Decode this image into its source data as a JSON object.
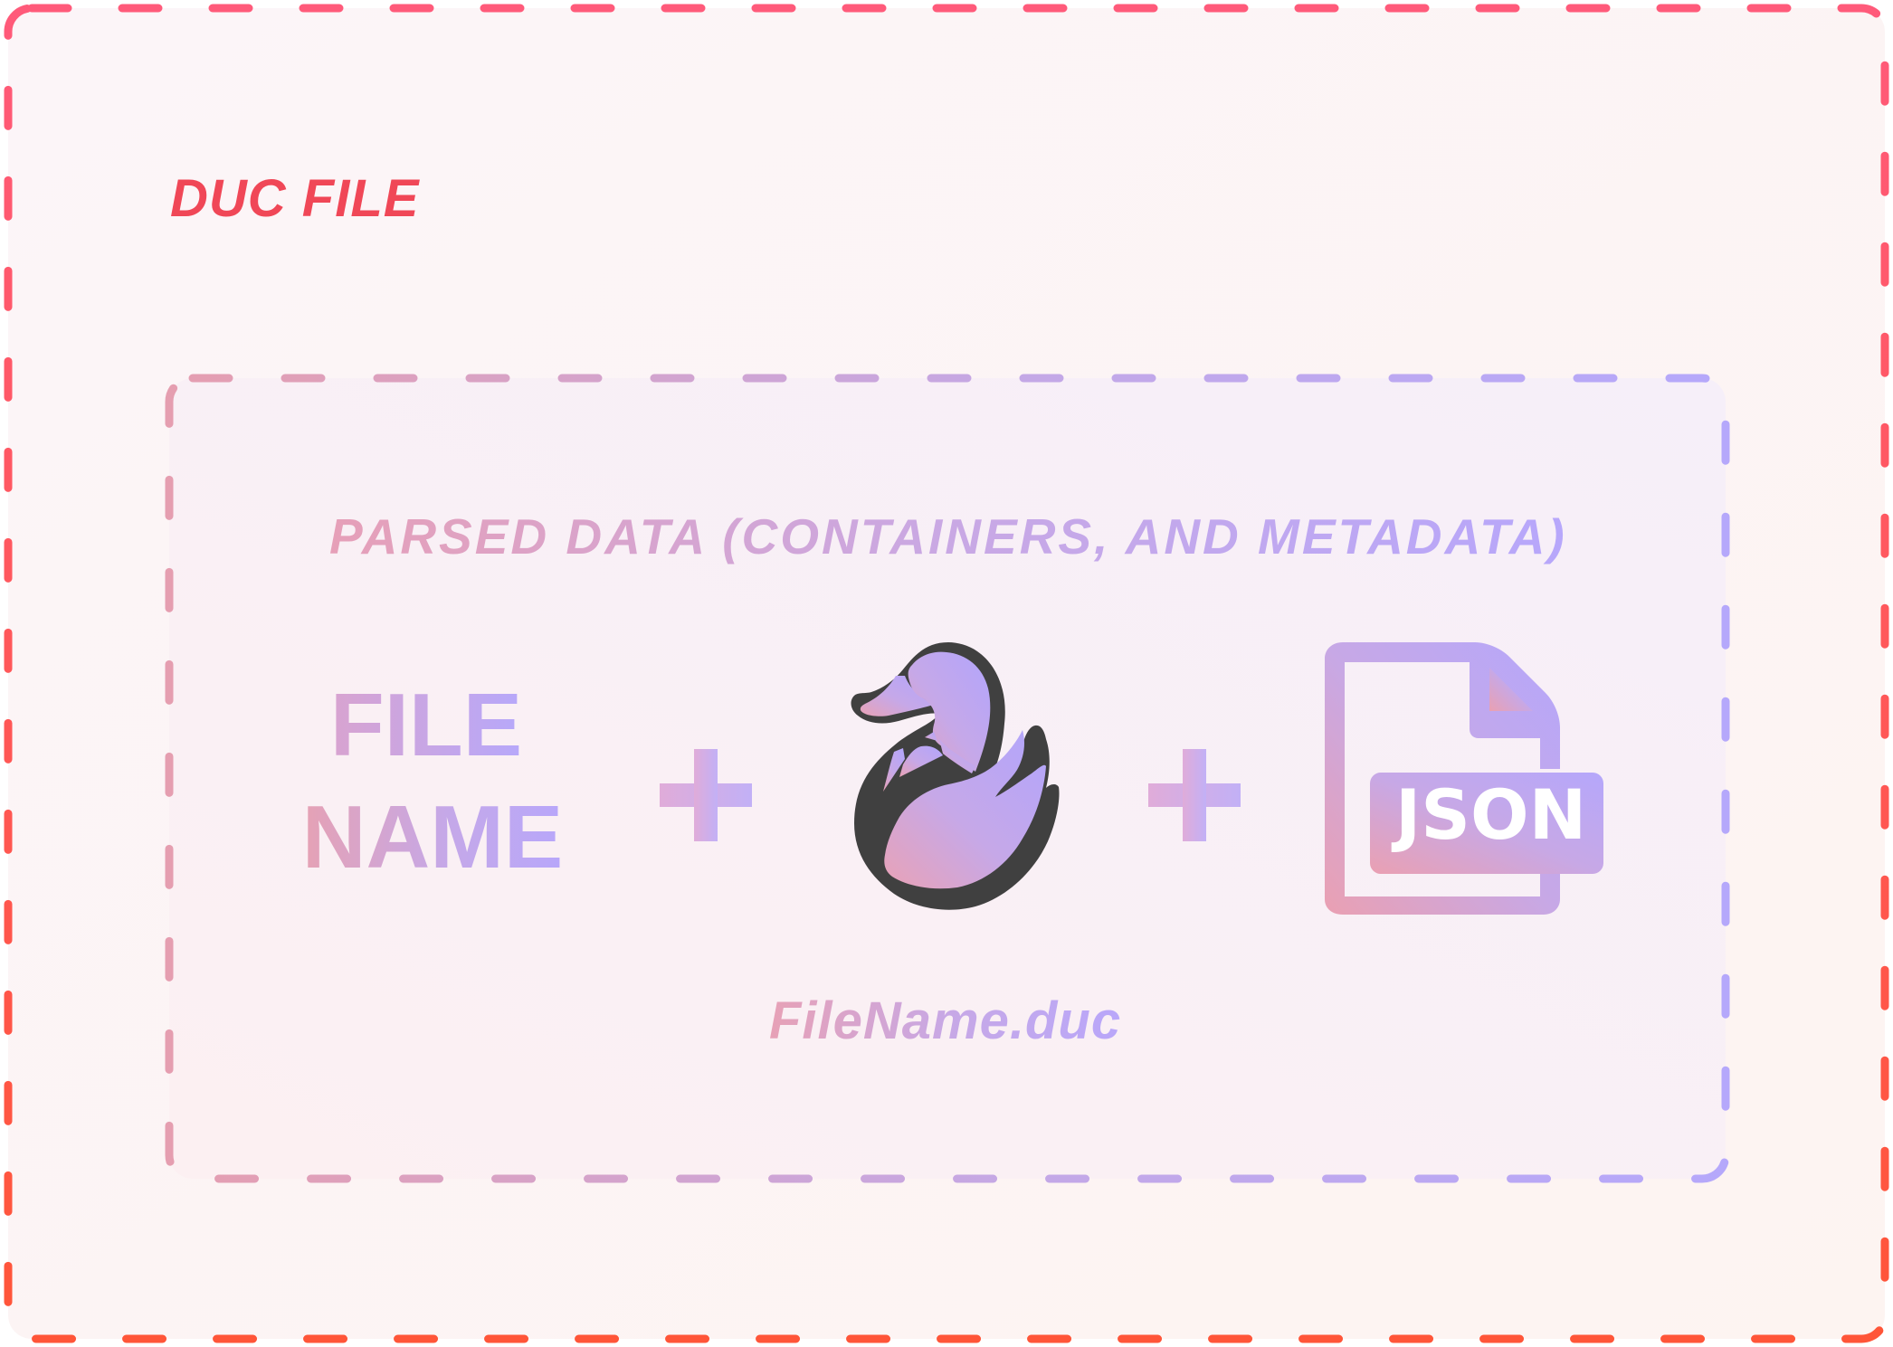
{
  "outer_container": {
    "title": "DUC FILE",
    "border_color": "#ff5c5c"
  },
  "inner_container": {
    "title": "PARSED DATA (CONTAINERS, AND METADATA)",
    "border_gradient": [
      "#e8a0ad",
      "#b7a7fb"
    ]
  },
  "components": {
    "file_name_line1": "FILE",
    "file_name_line2": "NAME",
    "plus_symbol": "+",
    "logo_icon": "duck-logo-icon",
    "json_icon_label": "JSON",
    "json_icon": "json-file-icon"
  },
  "output_filename": "FileName.duc",
  "colors": {
    "accent_red": "#f04757",
    "gradient_pink": "#e8a0b4",
    "gradient_lavender": "#b7a7fb",
    "logo_outline": "#404040"
  }
}
